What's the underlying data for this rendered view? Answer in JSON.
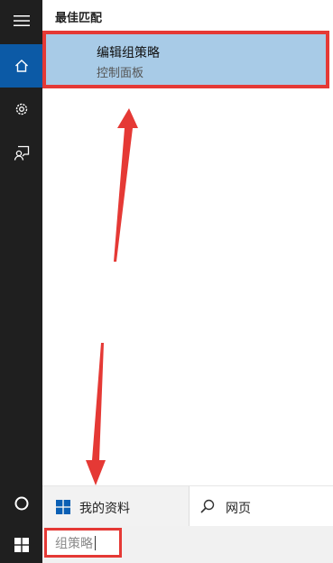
{
  "results": {
    "section_header": "最佳匹配",
    "best_match": {
      "title": "编辑组策略",
      "subtitle": "控制面板"
    }
  },
  "bottom": {
    "my_stuff_label": "我的资料",
    "web_label": "网页"
  },
  "search": {
    "value": "组策略"
  },
  "icons": {
    "menu": "hamburger-icon",
    "home": "home-icon",
    "settings": "gear-icon",
    "feedback": "feedback-icon",
    "cortana": "cortana-circle-icon",
    "windows": "windows-logo-icon",
    "search": "search-icon"
  },
  "colors": {
    "sidebar": "#1f1f1f",
    "home_active": "#0c5aa6",
    "highlight": "#a8cbe7",
    "annotation": "#e53935"
  }
}
